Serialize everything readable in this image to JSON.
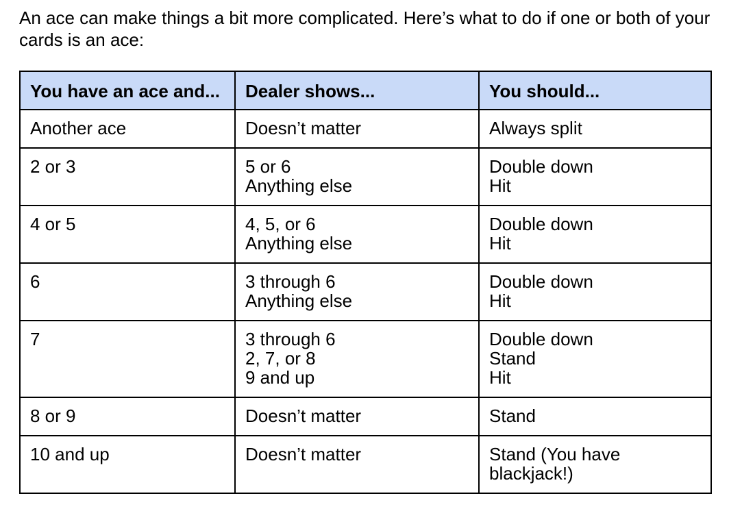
{
  "intro": "An ace can make things a bit more complicated. Here’s what to do if one or both of your cards is an ace:",
  "table": {
    "headers": [
      "You have an ace and...",
      "Dealer shows...",
      "You should..."
    ],
    "rows": [
      {
        "hand": "Another ace",
        "dealer": [
          "Doesn’t matter"
        ],
        "action": [
          "Always split"
        ]
      },
      {
        "hand": "2 or 3",
        "dealer": [
          "5 or 6",
          "Anything else"
        ],
        "action": [
          "Double down",
          "Hit"
        ]
      },
      {
        "hand": "4 or 5",
        "dealer": [
          "4, 5, or 6",
          "Anything else"
        ],
        "action": [
          "Double down",
          "Hit"
        ]
      },
      {
        "hand": "6",
        "dealer": [
          "3 through 6",
          "Anything else"
        ],
        "action": [
          "Double down",
          "Hit"
        ]
      },
      {
        "hand": "7",
        "dealer": [
          "3 through 6",
          "2, 7, or 8",
          "9 and up"
        ],
        "action": [
          "Double down",
          "Stand",
          "Hit"
        ]
      },
      {
        "hand": "8 or 9",
        "dealer": [
          "Doesn’t matter"
        ],
        "action": [
          "Stand"
        ]
      },
      {
        "hand": "10 and up",
        "dealer": [
          "Doesn’t matter"
        ],
        "action": [
          "Stand (You have blackjack!)"
        ]
      }
    ]
  }
}
